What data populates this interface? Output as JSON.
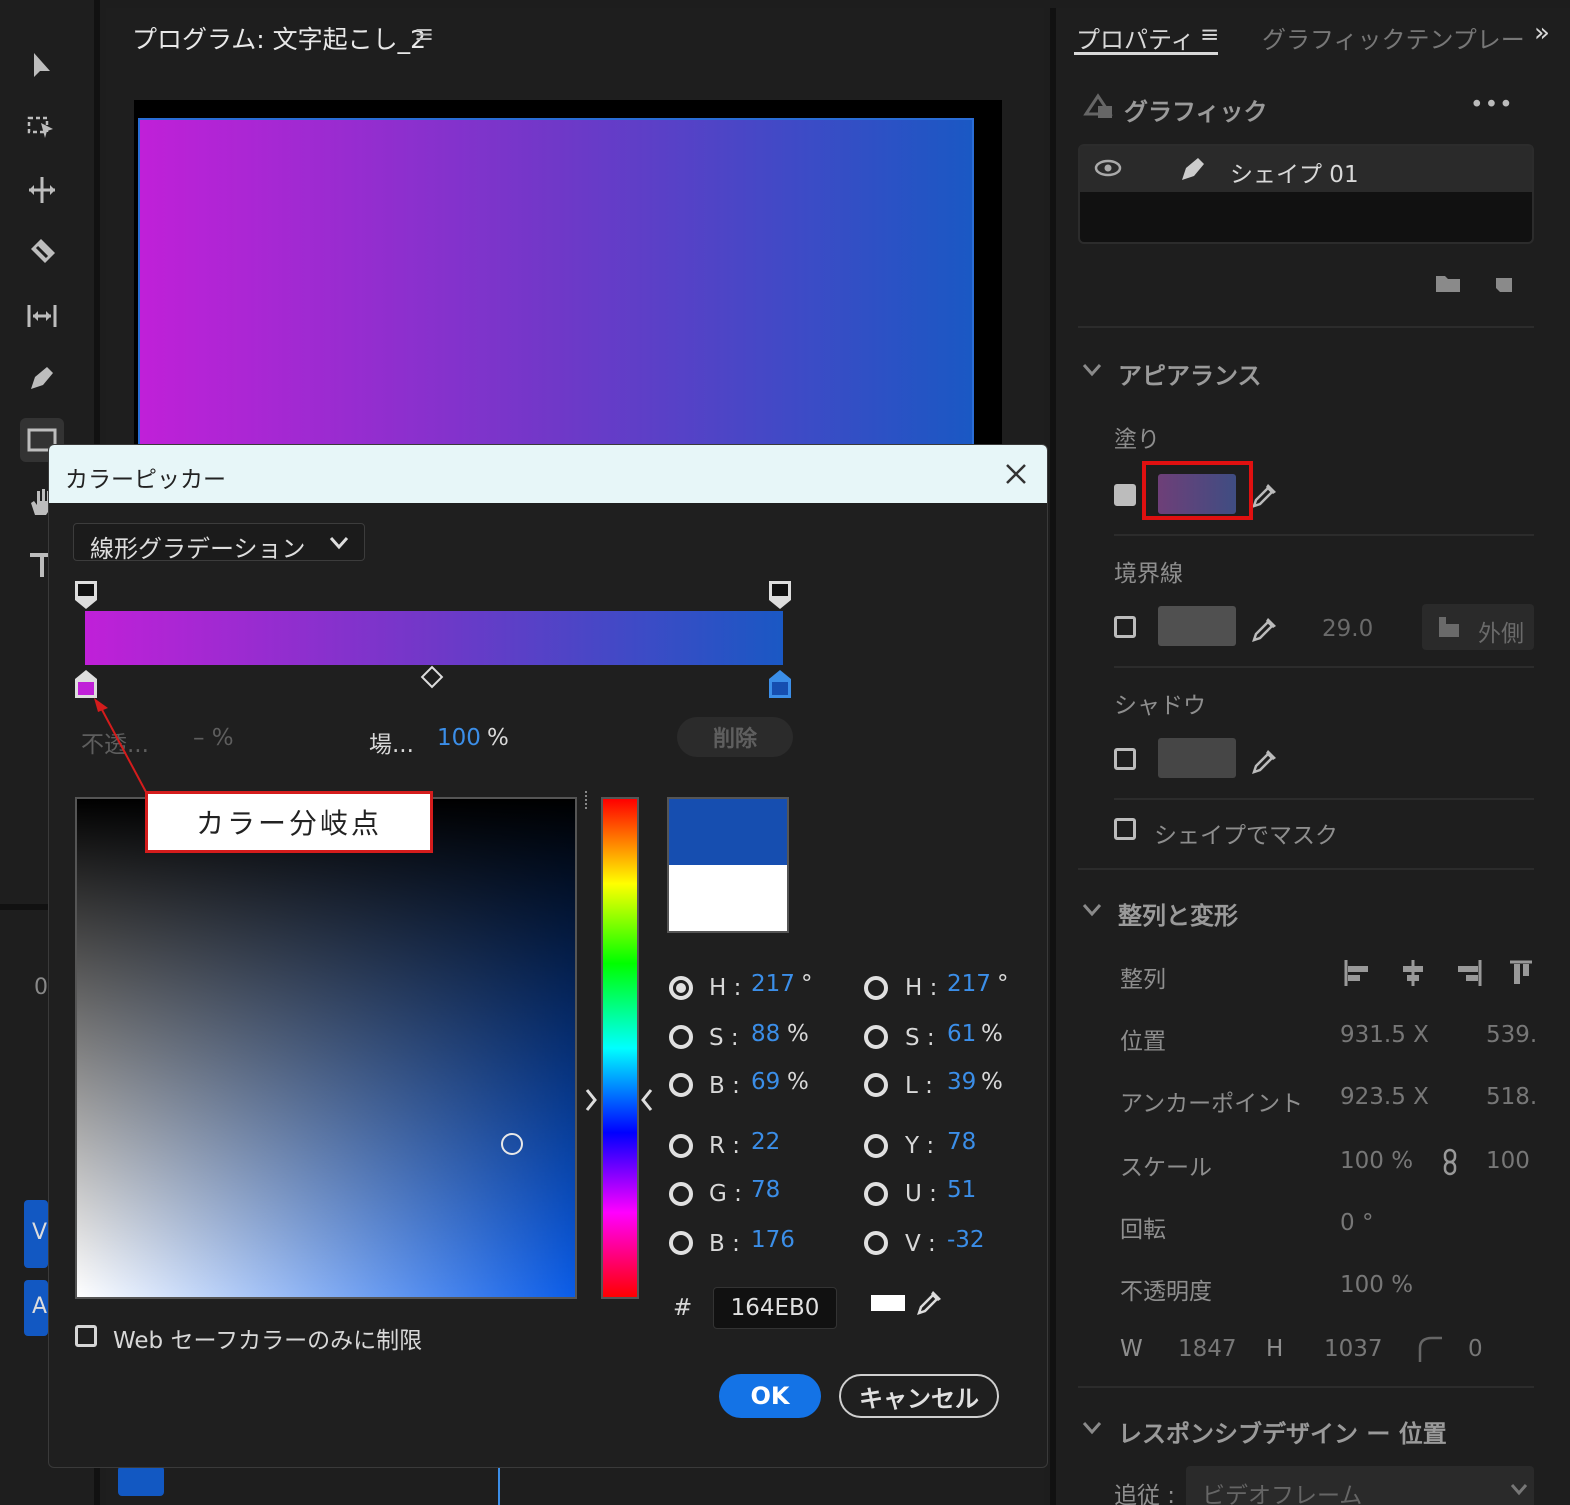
{
  "program": {
    "title": "プログラム: 文字起こし_2",
    "menu_glyph": "≡"
  },
  "toolbar": {
    "tools": [
      "selection-tool",
      "track-select-tool",
      "ripple-edit-tool",
      "razor-tool",
      "slip-tool",
      "pen-tool",
      "rectangle-tool",
      "hand-tool",
      "type-tool"
    ]
  },
  "timeline_fragments": {
    "v_label": "V",
    "a_label": "A",
    "zero": "0"
  },
  "right_panel": {
    "tab_properties": "プロパティ",
    "tab_properties_menu": "≡",
    "tab_graphic_templates": "グラフィックテンプレー",
    "overflow": "»",
    "section_graphic": "グラフィック",
    "more": "•••",
    "layer_name": "シェイプ 01",
    "section_appearance": "アピアランス",
    "fill_label": "塗り",
    "stroke_label": "境界線",
    "stroke_width": "29.0",
    "stroke_position": "外側",
    "shadow_label": "シャドウ",
    "mask_label": "シェイプでマスク",
    "section_align": "整列と変形",
    "align_label": "整列",
    "position_label": "位置",
    "position_x": "931.5 X",
    "position_y": "539.",
    "anchor_label": "アンカーポイント",
    "anchor_x": "923.5 X",
    "anchor_y": "518.",
    "scale_label": "スケール",
    "scale_value": "100 %",
    "scale_value2": "100",
    "rotation_label": "回転",
    "rotation_value": "0 °",
    "opacity_label": "不透明度",
    "opacity_value": "100 %",
    "w_label": "W",
    "w_value": "1847",
    "h_label": "H",
    "h_value": "1037",
    "corner_value": "0",
    "section_responsive": "レスポンシブデザイン ー 位置",
    "follow_label": "追従 :",
    "follow_value": "ビデオフレーム"
  },
  "picker": {
    "title": "カラーピッカー",
    "gradient_type": "線形グラデーション",
    "opacity_label": "不透...",
    "opacity_value": "– %",
    "location_label": "場...",
    "location_value": "100",
    "location_unit": "%",
    "delete_label": "削除",
    "hsb": {
      "h_label": "H :",
      "h_value": "217",
      "h_unit": "°",
      "s_label": "S :",
      "s_value": "88",
      "s_unit": "%",
      "b_label": "B :",
      "b_value": "69",
      "b_unit": "%"
    },
    "hsl": {
      "h_label": "H :",
      "h_value": "217",
      "h_unit": "°",
      "s_label": "S :",
      "s_value": "61",
      "s_unit": "%",
      "l_label": "L :",
      "l_value": "39",
      "l_unit": "%"
    },
    "rgb": {
      "r_label": "R :",
      "r_value": "22",
      "g_label": "G :",
      "g_value": "78",
      "b_label": "B :",
      "b_value": "176"
    },
    "yuv": {
      "y_label": "Y :",
      "y_value": "78",
      "u_label": "U :",
      "u_value": "51",
      "v_label": "V :",
      "v_value": "-32"
    },
    "hex_prefix": "#",
    "hex_value": "164EB0",
    "web_safe_label": "Web セーフカラーのみに制限",
    "ok_label": "OK",
    "cancel_label": "キャンセル"
  },
  "annotation": {
    "callout_text": "カラー分岐点"
  },
  "colors": {
    "gradient_start": "#c020d8",
    "gradient_end": "#1a58c4",
    "current_color": "#164EB0",
    "accent_blue": "#1473e6",
    "annotation_red": "#d41c1c"
  }
}
